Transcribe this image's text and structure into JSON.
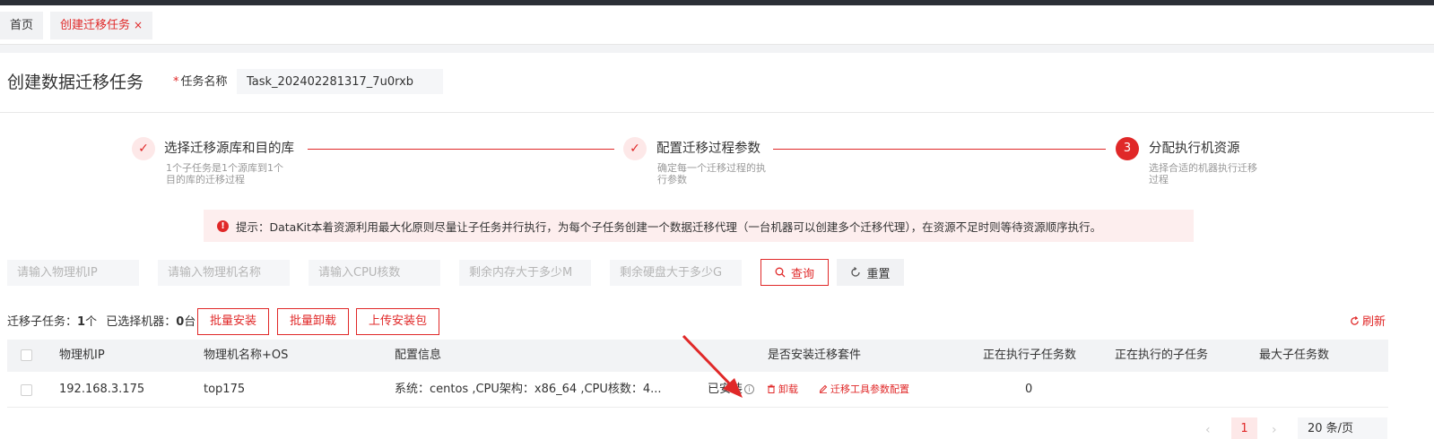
{
  "tabs": [
    {
      "label": "首页"
    },
    {
      "label": "创建迁移任务",
      "close": "×"
    }
  ],
  "header": {
    "title": "创建数据迁移任务",
    "task_name_required": "*",
    "task_name_label": "任务名称",
    "task_name_value": "Task_202402281317_7u0rxb"
  },
  "steps": [
    {
      "marker": "✓",
      "title": "选择迁移源库和目的库",
      "desc_line1": "1个子任务是1个源库到1个",
      "desc_line2": "目的库的迁移过程"
    },
    {
      "marker": "✓",
      "title": "配置迁移过程参数",
      "desc_line1": "确定每一个迁移过程的执",
      "desc_line2": "行参数"
    },
    {
      "marker": "3",
      "title": "分配执行机资源",
      "desc_line1": "选择合适的机器执行迁移",
      "desc_line2": "过程"
    }
  ],
  "notice": {
    "icon": "!",
    "text": "提示：DataKit本着资源利用最大化原则尽量让子任务并行执行，为每个子任务创建一个数据迁移代理（一台机器可以创建多个迁移代理），在资源不足时则等待资源顺序执行。"
  },
  "filters": {
    "ip_placeholder": "请输入物理机IP",
    "name_placeholder": "请输入物理机名称",
    "cpu_placeholder": "请输入CPU核数",
    "memory_placeholder": "剩余内存大于多少M",
    "disk_placeholder": "剩余硬盘大于多少G",
    "query_label": "查询",
    "reset_label": "重置"
  },
  "summary": {
    "subtask_label": "迁移子任务：",
    "subtask_count": "1",
    "subtask_unit": "个",
    "selected_label": "已选择机器：",
    "selected_count": "0",
    "selected_unit": "台"
  },
  "actions": {
    "batch_install": "批量安装",
    "batch_uninstall": "批量卸载",
    "upload_package": "上传安装包",
    "refresh": "刷新"
  },
  "table": {
    "columns": [
      "物理机IP",
      "物理机名称+OS",
      "配置信息",
      "是否安装迁移套件",
      "正在执行子任务数",
      "正在执行的子任务",
      "最大子任务数"
    ],
    "rows": [
      {
        "ip": "192.168.3.175",
        "name": "top175",
        "config": "系统：centos ,CPU架构：x86_64 ,CPU核数：4...",
        "install_status": "已安装",
        "uninstall_label": "卸载",
        "config_tool_label": "迁移工具参数配置",
        "running_count": "0"
      }
    ]
  },
  "pagination": {
    "prev": "‹",
    "current_page": "1",
    "next": "›",
    "page_size": "20 条/页"
  },
  "colors": {
    "accent": "#e02828",
    "accent_light": "#fde8e8",
    "notice_bg": "#fdeeee"
  }
}
